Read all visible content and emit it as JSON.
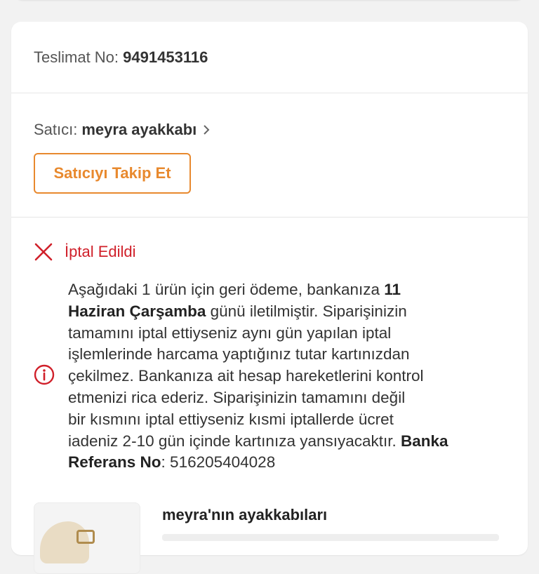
{
  "shipment": {
    "delivery_label": "Teslimat No:",
    "delivery_number": "9491453116"
  },
  "seller": {
    "label": "Satıcı:",
    "name": "meyra ayakkabı",
    "follow_button": "Satıcıyı Takip Et"
  },
  "status": {
    "label": "İptal Edildi",
    "color": "#d0202a"
  },
  "refund_info": {
    "line1_pre": "Aşağıdaki 1 ürün için geri ödeme, bankanıza ",
    "line1_bold": "11",
    "line2_bold": "Haziran Çarşamba",
    "line2_post": " günü iletilmiştir. Siparişinizin",
    "line3": "tamamını iptal ettiyseniz aynı gün yapılan iptal",
    "line4": "işlemlerinde harcama yaptığınız tutar kartınızdan",
    "line5": "çekilmez. Bankanıza ait hesap hareketlerini kontrol",
    "line6": "etmenizi rica ederiz. Siparişinizin tamamını değil",
    "line7": "bir kısmını iptal ettiyseniz kısmi iptallerde ücret",
    "line8_pre": "iadeniz 2-10 gün içinde kartınıza yansıyacaktır. ",
    "line8_bold": "Banka",
    "line9_bold": "Referans No",
    "line9_post": ": 516205404028"
  },
  "product": {
    "title": "meyra'nın ayakkabıları"
  },
  "colors": {
    "accent_orange": "#e8892e",
    "cancel_red": "#d0202a"
  },
  "icons": {
    "seller_chevron": "chevron-right-icon",
    "status": "close-icon",
    "info": "info-icon"
  }
}
